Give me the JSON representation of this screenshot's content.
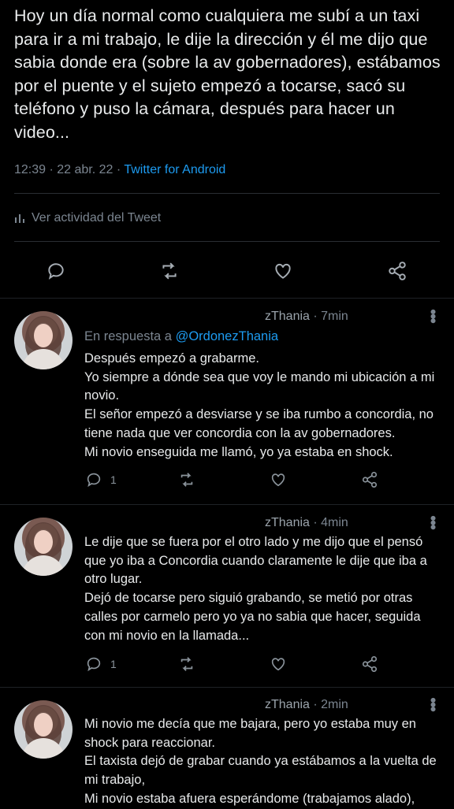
{
  "tweet": {
    "text": "Hoy un día normal como cualquiera me subí a un taxi para ir a mi trabajo, le dije la dirección y él me dijo que sabia donde era (sobre la av gobernadores), estábamos por el puente y el sujeto empezó a tocarse, sacó su teléfono y puso la cámara, después para hacer un video...",
    "time": "12:39 · 22 abr. 22 · ",
    "source": "Twitter for Android",
    "activity": "Ver actividad del Tweet",
    "icons": [
      "reply-icon",
      "retweet-icon",
      "like-icon",
      "share-icon"
    ]
  },
  "replies": [
    {
      "name": "zThania",
      "time": " · 7min",
      "replying_label": "En respuesta a ",
      "replying_handle": "@OrdonezThania",
      "text": "Después empezó a grabarme.\nYo siempre a dónde sea que voy le mando mi ubicación a mi novio.\nEl señor empezó a desviarse y se iba rumbo a concordia, no tiene nada que ver concordia con la av gobernadores.\nMi novio enseguida me llamó, yo ya estaba en shock.",
      "reply_count": "1"
    },
    {
      "name": "zThania",
      "time": " · 4min",
      "text": "Le dije que se fuera por el otro lado y me dijo que el pensó que yo iba a Concordia cuando claramente le dije que iba a otro lugar.\nDejó de tocarse pero siguió grabando, se metió por otras calles por carmelo pero yo ya no sabia que hacer, seguida con mi novio en la llamada...",
      "reply_count": "1"
    },
    {
      "name": "zThania",
      "time": " · 2min",
      "text": "Mi novio me decía que me bajara, pero yo estaba muy en shock para reaccionar.\nEl taxista dejó de grabar cuando ya estábamos a la vuelta de mi trabajo,\nMi novio estaba afuera esperándome (trabajamos alado),"
    }
  ]
}
